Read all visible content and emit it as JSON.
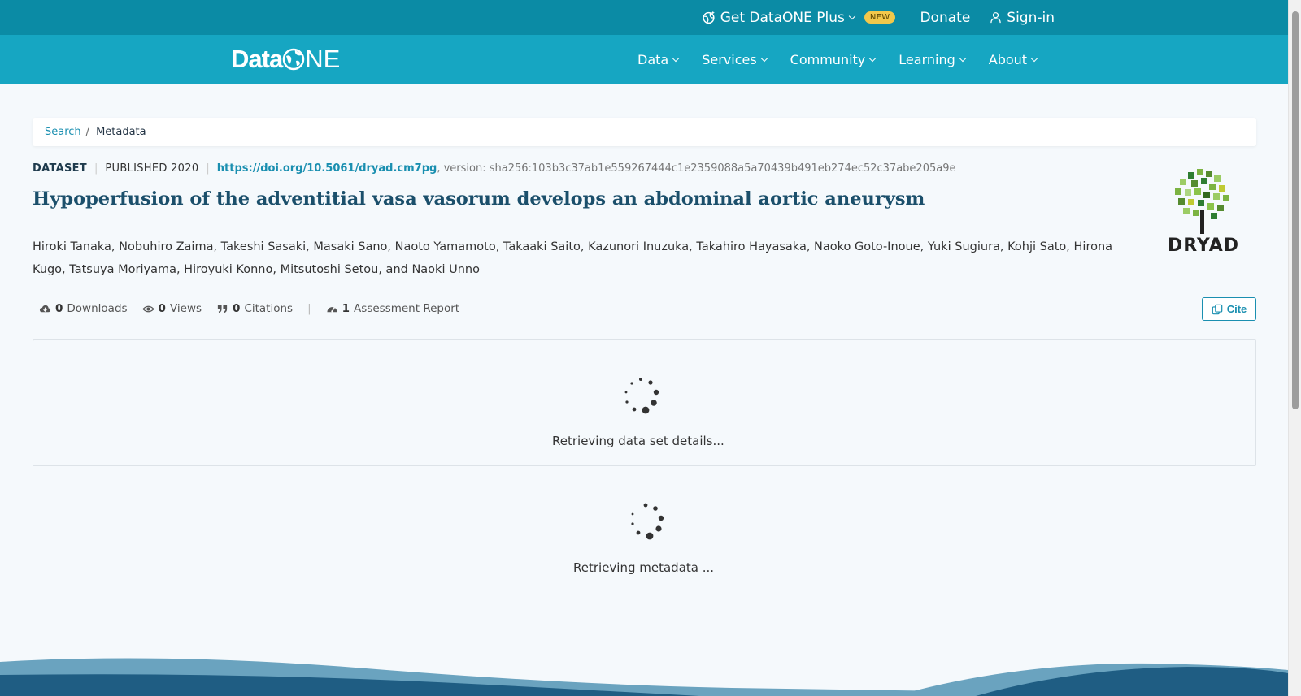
{
  "topbar": {
    "dataone_plus": "Get DataONE Plus",
    "new_badge": "NEW",
    "donate": "Donate",
    "signin": "Sign-in"
  },
  "nav": {
    "logo_data": "Data",
    "logo_one": "NE",
    "items": [
      {
        "label": "Data"
      },
      {
        "label": "Services"
      },
      {
        "label": "Community"
      },
      {
        "label": "Learning"
      },
      {
        "label": "About"
      }
    ]
  },
  "breadcrumb": {
    "search": "Search",
    "separator": "/",
    "current": "Metadata"
  },
  "dataset": {
    "type": "DATASET",
    "published": "PUBLISHED 2020",
    "doi": "https://doi.org/10.5061/dryad.cm7pg",
    "version": ", version: sha256:103b3c37ab1e559267444c1e2359088a5a70439b491eb274ec52c37abe205a9e",
    "title": "Hypoperfusion of the adventitial vasa vasorum develops an abdominal aortic aneurysm",
    "authors": "Hiroki Tanaka, Nobuhiro Zaima, Takeshi Sasaki, Masaki Sano, Naoto Yamamoto, Takaaki Saito, Kazunori Inuzuka, Takahiro Hayasaka, Naoko Goto-Inoue, Yuki Sugiura, Kohji Sato, Hirona Kugo, Tatsuya Moriyama, Hiroyuki Konno, Mitsutoshi Setou, and Naoki Unno",
    "repository": "DRYAD"
  },
  "metrics": {
    "downloads_count": "0",
    "downloads_label": "Downloads",
    "views_count": "0",
    "views_label": "Views",
    "citations_count": "0",
    "citations_label": "Citations",
    "assessment_count": "1",
    "assessment_label": "Assessment Report",
    "cite_label": "Cite"
  },
  "loading": {
    "details": "Retrieving data set details...",
    "metadata": "Retrieving metadata ..."
  },
  "colors": {
    "topbar": "#0b8ba5",
    "nav": "#16a6c2",
    "accent": "#1a8fb0",
    "title": "#1b4f6b"
  }
}
